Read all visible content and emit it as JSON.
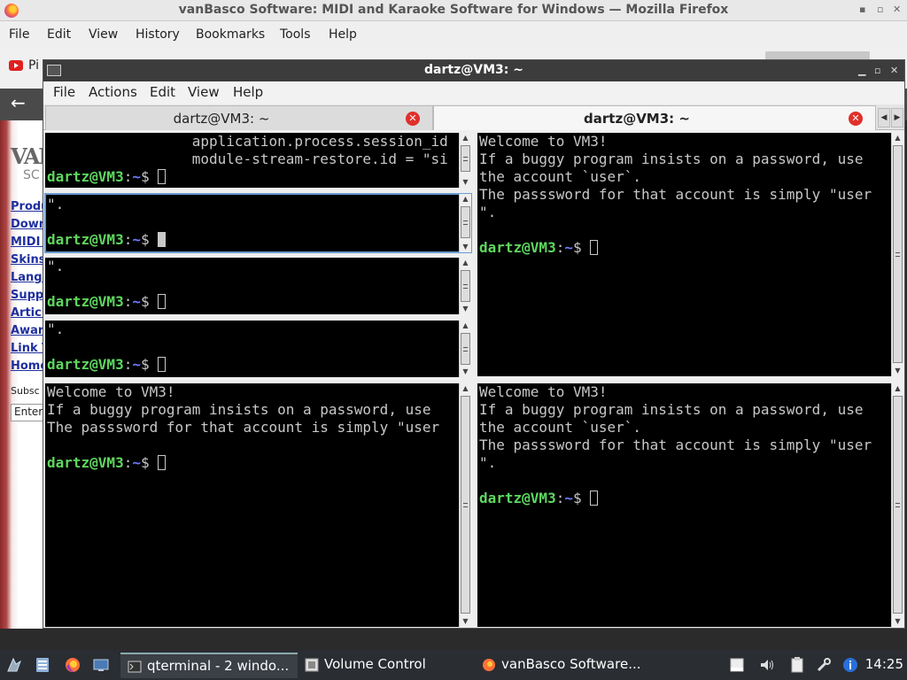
{
  "firefox": {
    "title": "vanBasco Software: MIDI and Karaoke Software for Windows — Mozilla Firefox",
    "menu": [
      "File",
      "Edit",
      "View",
      "History",
      "Bookmarks",
      "Tools",
      "Help"
    ],
    "tab_partial": "Pi",
    "page": {
      "logo": "VAN",
      "logo_sub": "SC",
      "links": [
        "Produ",
        "Down",
        "MIDI S",
        "Skins",
        "Langu",
        "Suppo",
        "Articl",
        "Award",
        "Link T",
        "Home"
      ],
      "subscribe": "Subsc",
      "input_placeholder": "Enter"
    }
  },
  "qterminal": {
    "title": "dartz@VM3: ~",
    "menu": [
      "File",
      "Actions",
      "Edit",
      "View",
      "Help"
    ],
    "tabs": [
      {
        "label": "dartz@VM3: ~",
        "active": false
      },
      {
        "label": "dartz@VM3: ~",
        "active": true
      }
    ],
    "prompt": {
      "user": "dartz@VM3",
      "sep": ":",
      "path": "~",
      "sym": "$ "
    },
    "panes": {
      "left1": {
        "lines": [
          "                 application.process.session_id",
          "                 module-stream-restore.id = \"si"
        ]
      },
      "left2": {
        "lines": [
          "\"."
        ]
      },
      "left3": {
        "lines": [
          "\"."
        ]
      },
      "left4": {
        "lines": [
          "\"."
        ]
      },
      "left5": {
        "lines": [
          "Welcome to VM3!",
          "If a buggy program insists on a password, use",
          "The passsword for that account is simply \"user"
        ]
      },
      "right_top": {
        "lines": [
          "Welcome to VM3!",
          "If a buggy program insists on a password, use",
          "the account `user`.",
          "The passsword for that account is simply \"user",
          "\"."
        ]
      },
      "right_bottom": {
        "lines": [
          "Welcome to VM3!",
          "If a buggy program insists on a password, use",
          "the account `user`.",
          "The passsword for that account is simply \"user",
          "\"."
        ]
      }
    }
  },
  "taskbar": {
    "tasks": [
      {
        "label": "qterminal - 2 windo...",
        "icon": "terminal-icon",
        "active": true
      },
      {
        "label": "Volume Control",
        "icon": "volume-control-icon",
        "active": false
      },
      {
        "label": "vanBasco Software...",
        "icon": "firefox-icon",
        "active": false
      }
    ],
    "clock": "14:25"
  }
}
